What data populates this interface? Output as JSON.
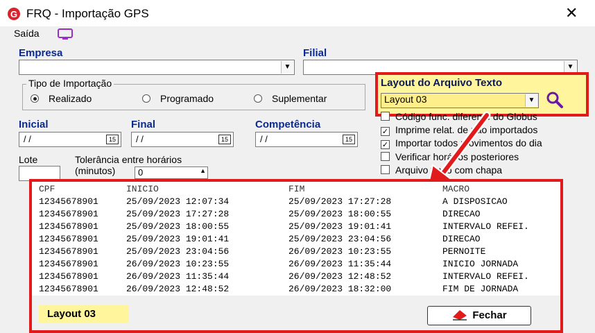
{
  "window": {
    "title": "FRQ - Importação GPS",
    "close_glyph": "✕"
  },
  "menu": {
    "saida": "Saída"
  },
  "empresa": {
    "label": "Empresa",
    "value": ""
  },
  "filial": {
    "label": "Filial",
    "value": ""
  },
  "tipo": {
    "legend": "Tipo de Importação",
    "options": [
      {
        "label": "Realizado",
        "selected": true
      },
      {
        "label": "Programado",
        "selected": false
      },
      {
        "label": "Suplementar",
        "selected": false
      }
    ]
  },
  "layout_arquivo": {
    "label": "Layout do Arquivo Texto",
    "value": "Layout 03"
  },
  "dates": {
    "inicial": {
      "label": "Inicial",
      "value": "/ /"
    },
    "final": {
      "label": "Final",
      "value": "/ /"
    },
    "competencia": {
      "label": "Competência",
      "value": "/ /"
    },
    "cal_glyph": "15"
  },
  "lote": {
    "label": "Lote",
    "value": ""
  },
  "tolerancia": {
    "label1": "Tolerância entre horários",
    "label2": "(minutos)",
    "value": "0"
  },
  "checks": [
    {
      "label": "Código func. diferente do Globus",
      "checked": false
    },
    {
      "label": "Imprime relat. de não importados",
      "checked": true
    },
    {
      "label": "Importar todos movimentos do dia",
      "checked": true
    },
    {
      "label": "Verificar horários posteriores",
      "checked": false
    },
    {
      "label": "Arquivo texto com chapa",
      "checked": false
    }
  ],
  "preview": {
    "headers": [
      "CPF",
      "INICIO",
      "FIM",
      "MACRO"
    ],
    "rows": [
      [
        "12345678901",
        "25/09/2023 12:07:34",
        "25/09/2023 17:27:28",
        "A DISPOSICAO"
      ],
      [
        "12345678901",
        "25/09/2023 17:27:28",
        "25/09/2023 18:00:55",
        "DIRECAO"
      ],
      [
        "12345678901",
        "25/09/2023 18:00:55",
        "25/09/2023 19:01:41",
        "INTERVALO REFEI."
      ],
      [
        "12345678901",
        "25/09/2023 19:01:41",
        "25/09/2023 23:04:56",
        "DIRECAO"
      ],
      [
        "12345678901",
        "25/09/2023 23:04:56",
        "26/09/2023 10:23:55",
        "PERNOITE"
      ],
      [
        "12345678901",
        "26/09/2023 10:23:55",
        "26/09/2023 11:35:44",
        "INICIO JORNADA"
      ],
      [
        "12345678901",
        "26/09/2023 11:35:44",
        "26/09/2023 12:48:52",
        "INTERVALO REFEI."
      ],
      [
        "12345678901",
        "26/09/2023 12:48:52",
        "26/09/2023 18:32:00",
        "FIM DE JORNADA"
      ]
    ],
    "layout_tag": "Layout 03",
    "close_button": "Fechar"
  },
  "colors": {
    "accent_red": "#e11b1b",
    "highlight_yellow": "#fff59d",
    "label_blue": "#0b2a8f"
  }
}
